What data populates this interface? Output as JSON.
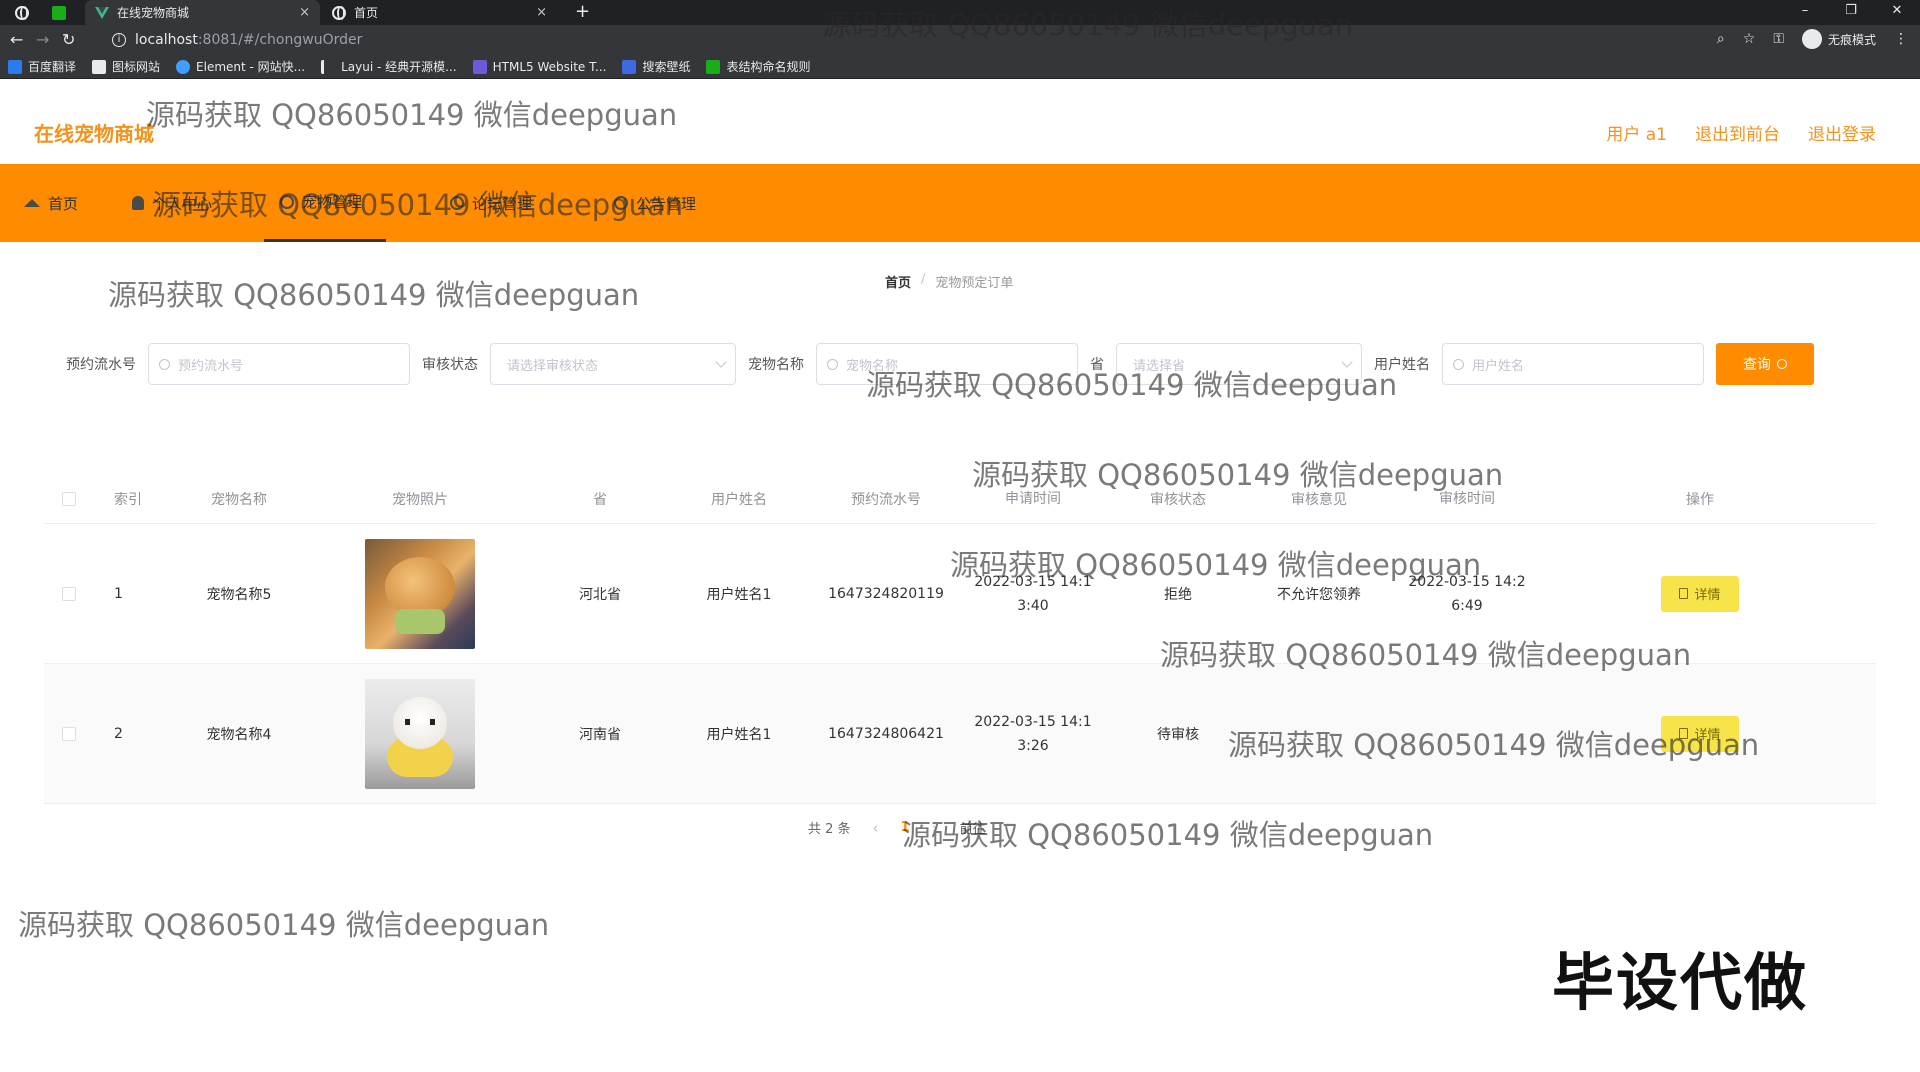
{
  "browser": {
    "tabs": [
      {
        "title": "在线宠物商城",
        "close": "×"
      },
      {
        "title": "首页",
        "close": "×"
      }
    ],
    "new_tab": "+",
    "url_host": "localhost",
    "url_path": ":8081/#/chongwuOrder",
    "incognito_label": "无痕模式",
    "bookmarks": [
      "百度翻译",
      "图标网站",
      "Element - 网站快...",
      "Layui - 经典开源模...",
      "HTML5 Website T...",
      "搜索壁纸",
      "表结构命名规则"
    ],
    "window_controls": [
      "–",
      "❐",
      "✕"
    ]
  },
  "header": {
    "logo": "在线宠物商城",
    "user": "用户 a1",
    "back_front": "退出到前台",
    "logout": "退出登录"
  },
  "menu": [
    {
      "label": "首页",
      "icon": "home-icon"
    },
    {
      "label": "个人中心",
      "icon": "user-icon"
    },
    {
      "label": "宠物管理",
      "icon": "circle-icon"
    },
    {
      "label": "论坛管理",
      "icon": "circle-icon"
    },
    {
      "label": "公告管理",
      "icon": "circle-icon"
    }
  ],
  "breadcrumb": {
    "home": "首页",
    "separator": "/",
    "current": "宠物预定订单"
  },
  "search": {
    "serial_label": "预约流水号",
    "serial_placeholder": "预约流水号",
    "status_label": "审核状态",
    "status_placeholder": "请选择审核状态",
    "pet_label": "宠物名称",
    "pet_placeholder": "宠物名称",
    "province_label": "省",
    "province_placeholder": "请选择省",
    "user_label": "用户姓名",
    "user_placeholder": "用户姓名",
    "query_button": "查询"
  },
  "table": {
    "columns": [
      "索引",
      "宠物名称",
      "宠物照片",
      "省",
      "用户姓名",
      "预约流水号",
      "申请时间",
      "审核状态",
      "审核意见",
      "审核时间",
      "操作"
    ],
    "rows": [
      {
        "index": "1",
        "pet": "宠物名称5",
        "province": "河北省",
        "user": "用户姓名1",
        "serial": "1647324820119",
        "apply_time_1": "2022-03-15 14:1",
        "apply_time_2": "3:40",
        "status": "拒绝",
        "opinion": "不允许您领养",
        "audit_time_1": "2022-03-15 14:2",
        "audit_time_2": "6:49",
        "action": "详情"
      },
      {
        "index": "2",
        "pet": "宠物名称4",
        "province": "河南省",
        "user": "用户姓名1",
        "serial": "1647324806421",
        "apply_time_1": "2022-03-15 14:1",
        "apply_time_2": "3:26",
        "status": "待审核",
        "opinion": "",
        "audit_time_1": "",
        "audit_time_2": "",
        "action": "详情"
      }
    ]
  },
  "pagination": {
    "total": "共 2 条",
    "prev": "‹",
    "page": "1",
    "next": "›",
    "goto": "前往"
  },
  "watermark": "源码获取 QQ86050149 微信deepguan",
  "promo": "毕设代做",
  "colors": {
    "accent": "#ff8c00",
    "logo": "#f5921a",
    "detail_button": "#f7e44b"
  }
}
